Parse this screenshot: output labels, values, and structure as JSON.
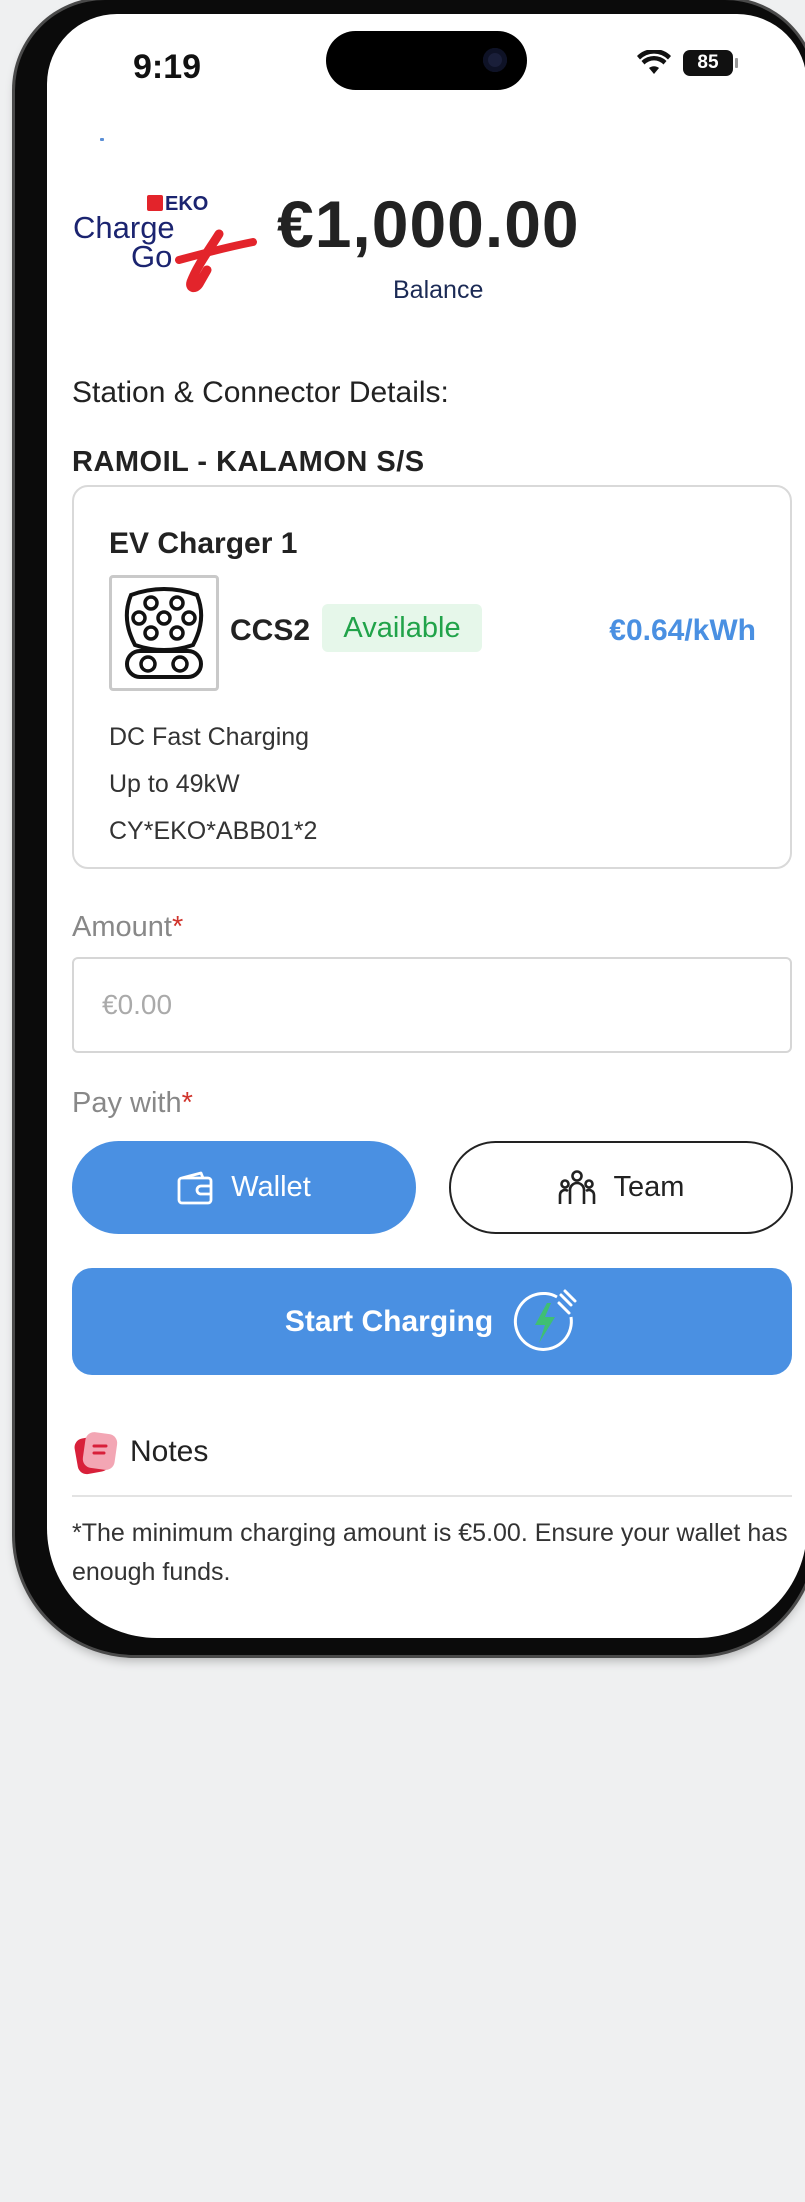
{
  "status_bar": {
    "time": "9:19",
    "battery": "85"
  },
  "brand": {
    "top": "EKO",
    "line1": "Charge",
    "line2": "Go"
  },
  "balance": {
    "amount": "€1,000.00",
    "label": "Balance"
  },
  "section_title": "Station & Connector Details:",
  "station_name": "RAMOIL - KALAMON S/S",
  "charger": {
    "title": "EV Charger 1",
    "connector": "CCS2",
    "status": "Available",
    "price": "€0.64/kWh",
    "details": [
      "DC Fast Charging",
      "Up to 49kW",
      "CY*EKO*ABB01*2"
    ]
  },
  "amount_field": {
    "label": "Amount",
    "required_mark": "*",
    "placeholder": "€0.00"
  },
  "pay_with": {
    "label": "Pay with",
    "required_mark": "*",
    "options": {
      "wallet": "Wallet",
      "team": "Team"
    }
  },
  "start_button": {
    "label": "Start Charging"
  },
  "notes": {
    "title": "Notes",
    "text": "*The minimum charging amount is €5.00. Ensure your wallet has enough funds."
  },
  "colors": {
    "accent": "#4a90e2",
    "available_text": "#21a34a",
    "available_bg": "#e6f7ea",
    "brand_red": "#e3242b",
    "brand_navy": "#1b2470"
  }
}
